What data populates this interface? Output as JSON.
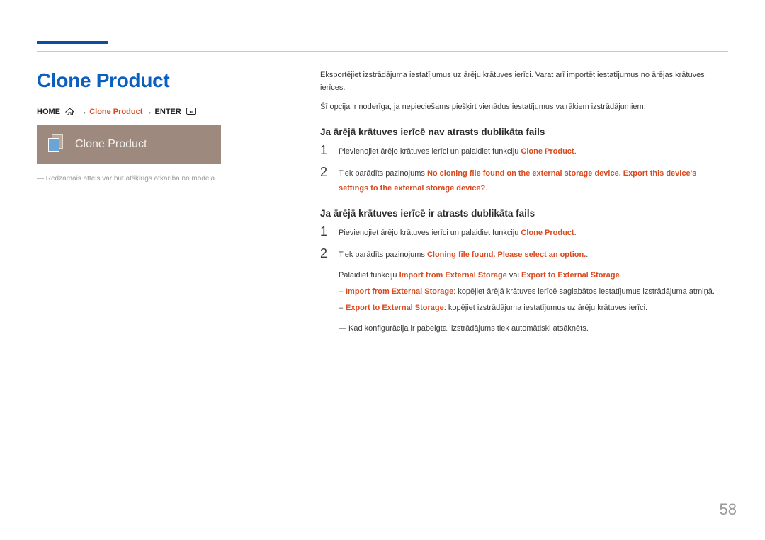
{
  "title": "Clone Product",
  "breadcrumb": {
    "home": "HOME",
    "arrow1": "→",
    "product": "Clone Product",
    "arrow2": "→",
    "enter": "ENTER"
  },
  "tile_label": "Clone Product",
  "left_note": "― Redzamais attēls var būt atšķirīgs atkarībā no modeļa.",
  "intro1": "Eksportējiet izstrādājuma iestatījumus uz ārēju krātuves ierīci. Varat arī importēt iestatījumus no ārējas krātuves ierīces.",
  "intro2": "Šī opcija ir noderīga, ja nepieciešams piešķirt vienādus iestatījumus vairākiem izstrādājumiem.",
  "section1_heading": "Ja ārējā krātuves ierīcē nav atrasts dublikāta fails",
  "s1_step1_num": "1",
  "s1_step1_text_a": "Pievienojiet ārējo krātuves ierīci un palaidiet funkciju ",
  "s1_step1_text_b": "Clone Product",
  "s1_step1_text_c": ".",
  "s1_step2_num": "2",
  "s1_step2_text_a": "Tiek parādīts paziņojums ",
  "s1_step2_text_b": "No cloning file found on the external storage device. Export this device's settings to the external storage device?",
  "s1_step2_text_c": ".",
  "section2_heading": "Ja ārējā krātuves ierīcē ir atrasts dublikāta fails",
  "s2_step1_num": "1",
  "s2_step1_text_a": "Pievienojiet ārējo krātuves ierīci un palaidiet funkciju ",
  "s2_step1_text_b": "Clone Product",
  "s2_step1_text_c": ".",
  "s2_step2_num": "2",
  "s2_step2_text_a": "Tiek parādīts paziņojums ",
  "s2_step2_text_b": "Cloning file found. Please select an option.",
  "s2_step2_text_c": ".",
  "s2_run_a": "Palaidiet funkciju ",
  "s2_run_b": "Import from External Storage",
  "s2_run_c": " vai ",
  "s2_run_d": "Export to External Storage",
  "s2_run_e": ".",
  "s2_bul1_dash": "‒ ",
  "s2_bul1_a": "Import from External Storage",
  "s2_bul1_b": ": kopējiet ārējā krātuves ierīcē saglabātos iestatījumus izstrādājuma atmiņā.",
  "s2_bul2_dash": "‒ ",
  "s2_bul2_a": "Export to External Storage",
  "s2_bul2_b": ": kopējiet izstrādājuma iestatījumus uz ārēju krātuves ierīci.",
  "foot_note": "― Kad konfigurācija ir pabeigta, izstrādājums tiek automātiski atsāknēts.",
  "page_number": "58"
}
